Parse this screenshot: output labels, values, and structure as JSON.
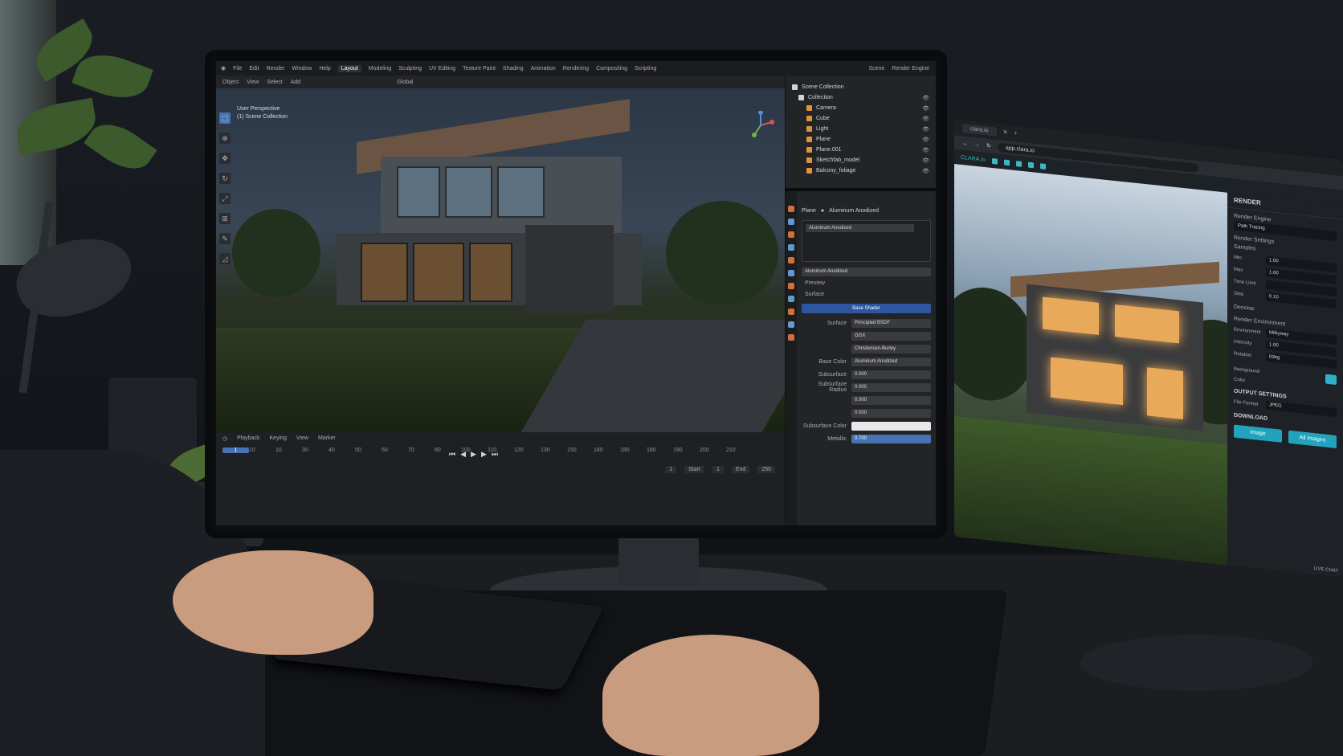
{
  "blender": {
    "menu": [
      "File",
      "Edit",
      "Render",
      "Window",
      "Help"
    ],
    "workspaces": [
      "Layout",
      "Modeling",
      "Sculpting",
      "UV Editing",
      "Texture Paint",
      "Shading",
      "Animation",
      "Rendering",
      "Compositing",
      "Scripting"
    ],
    "active_workspace": "Layout",
    "scene_label": "Scene",
    "render_engine_label": "Render Engine",
    "toolbar": [
      "Object",
      "View",
      "Select",
      "Add"
    ],
    "transform_orientation": "Global",
    "viewport_overlay_line1": "User Perspective",
    "viewport_overlay_line2": "(1) Scene Collection",
    "outliner": {
      "root": "Scene Collection",
      "collection": "Collection",
      "items": [
        "Camera",
        "Cube",
        "Light",
        "Plane",
        "Plane.001",
        "Sketchfab_model",
        "Balcony_foliage"
      ]
    },
    "properties": {
      "object_name": "Plane",
      "material_name": "Aluminum Anodized",
      "material_slot": "Aluminum Anodized",
      "material_field": "Aluminum Anodized",
      "section_preview": "Preview",
      "section_surface": "Surface",
      "surface_bar": "Base Shader",
      "rows": [
        {
          "label": "Surface",
          "value": "Principled BSDF"
        },
        {
          "label": "",
          "value": "GGX"
        },
        {
          "label": "",
          "value": "Christensen-Burley"
        },
        {
          "label": "Base Color",
          "value": "Aluminum Anodized"
        },
        {
          "label": "Subsurface",
          "value": "0.000"
        },
        {
          "label": "Subsurface Radius",
          "value": "0.000"
        },
        {
          "label": "",
          "value": "0.000"
        },
        {
          "label": "",
          "value": "0.000"
        },
        {
          "label": "Subsurface Color",
          "value": ""
        },
        {
          "label": "Metallic",
          "value": "0.700"
        }
      ]
    },
    "timeline": {
      "menus": [
        "Playback",
        "Keying",
        "View",
        "Marker"
      ],
      "ruler": [
        "20",
        "10",
        "10",
        "30",
        "40",
        "50",
        "60",
        "70",
        "80",
        "100",
        "110",
        "120",
        "130",
        "150",
        "180",
        "180",
        "180",
        "190",
        "200",
        "210",
        "220",
        "230",
        "240",
        "250"
      ],
      "current_frame": "1",
      "start_label": "Start",
      "start_value": "1",
      "end_label": "End",
      "end_value": "250"
    }
  },
  "browser": {
    "tab_title": "clara.io",
    "url": "app.clara.io",
    "app_name": "CLARA.io"
  },
  "render_panel": {
    "title": "RENDER",
    "render_engine_label": "Render Engine",
    "render_engine_value": "Path Tracing",
    "render_settings_label": "Render Settings",
    "samples_label": "Samples",
    "rows": [
      {
        "key": "Min",
        "value": "1.00"
      },
      {
        "key": "Max",
        "value": "1.00"
      },
      {
        "key": "Time Limit",
        "value": ""
      },
      {
        "key": "Step",
        "value": "0.10"
      }
    ],
    "denoise_label": "Denoise",
    "environment_label": "Render Environment",
    "env_rows": [
      {
        "key": "Environment",
        "value": "Milkyway"
      },
      {
        "key": "Intensity",
        "value": "1.00"
      },
      {
        "key": "Rotation",
        "value": "0deg"
      }
    ],
    "background_label": "Background",
    "color_label": "Color",
    "output_label": "OUTPUT SETTINGS",
    "file_format_label": "File Format",
    "file_format_value": "JPEG",
    "download_label": "DOWNLOAD",
    "image_button": "Image",
    "all_images_button": "All Images",
    "live_chat": "LIVE CHAT",
    "accent": "#22a3bd"
  }
}
